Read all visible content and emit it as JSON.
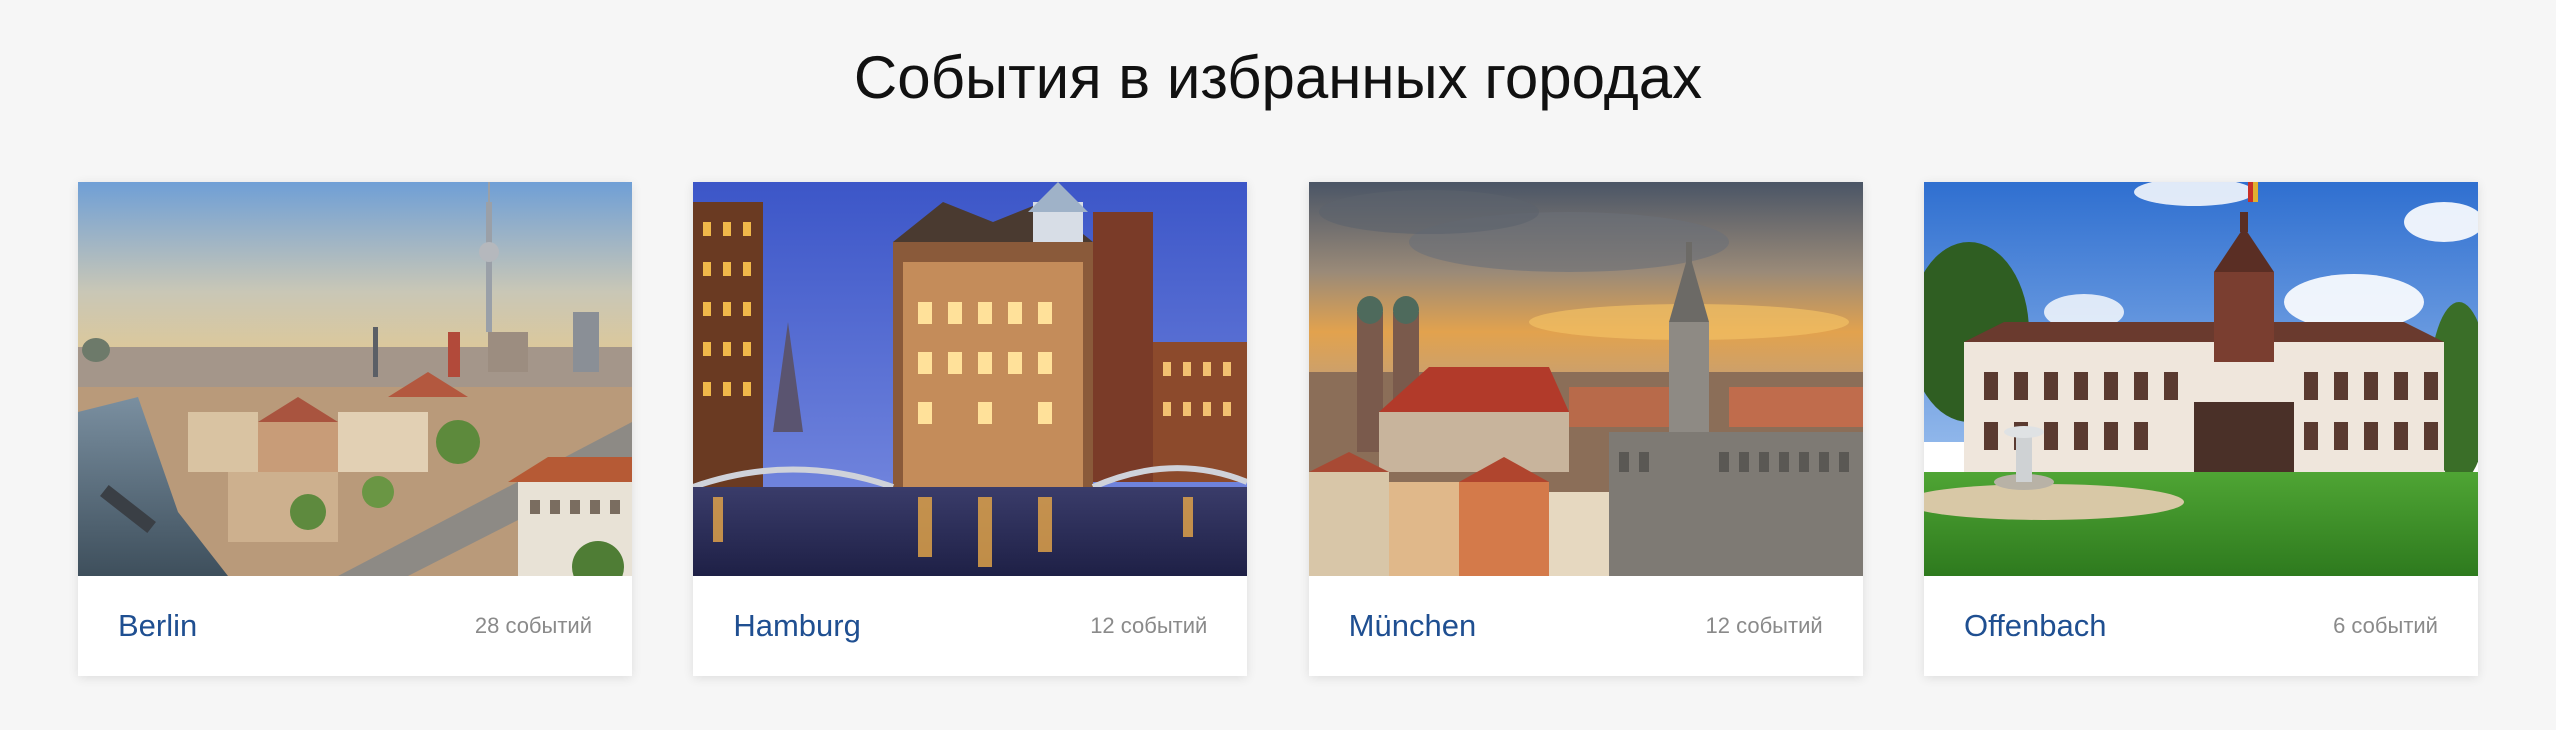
{
  "section": {
    "title": "События в избранных городах"
  },
  "cities": [
    {
      "name": "Berlin",
      "events_label": "28 событий",
      "photo": "berlin-skyline-photo"
    },
    {
      "name": "Hamburg",
      "events_label": "12 событий",
      "photo": "hamburg-speicherstadt-photo"
    },
    {
      "name": "München",
      "events_label": "12 событий",
      "photo": "munich-cityscape-photo"
    },
    {
      "name": "Offenbach",
      "events_label": "6 событий",
      "photo": "offenbach-palace-photo"
    }
  ],
  "colors": {
    "background": "#f6f6f6",
    "card": "#ffffff",
    "city_link": "#1f4f91",
    "count_text": "#8a8a8a",
    "title_text": "#111111"
  }
}
